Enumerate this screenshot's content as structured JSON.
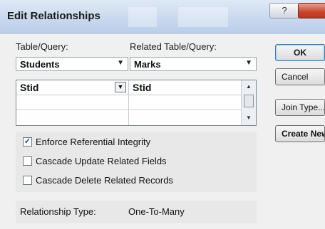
{
  "window": {
    "title": "Edit Relationships",
    "help_glyph": "?"
  },
  "labels": {
    "table_query": "Table/Query:",
    "related_table_query": "Related Table/Query:"
  },
  "combos": {
    "table": "Students",
    "related_table": "Marks"
  },
  "grid": {
    "rows": [
      {
        "left": "Stid",
        "right": "Stid"
      },
      {
        "left": "",
        "right": ""
      },
      {
        "left": "",
        "right": ""
      }
    ]
  },
  "checkboxes": [
    {
      "label": "Enforce Referential Integrity",
      "checked": true
    },
    {
      "label": "Cascade Update Related Fields",
      "checked": false
    },
    {
      "label": "Cascade Delete Related Records",
      "checked": false
    }
  ],
  "relationship_type": {
    "label": "Relationship Type:",
    "value": "One-To-Many"
  },
  "buttons": {
    "ok": "OK",
    "cancel": "Cancel",
    "join_type": "Join Type...",
    "create_new": "Create New..."
  },
  "glyphs": {
    "dropdown": "▼",
    "scroll_up": "▲",
    "scroll_down": "▼",
    "check": "✓"
  }
}
